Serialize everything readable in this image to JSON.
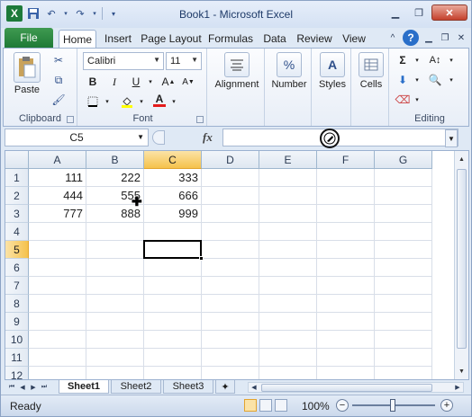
{
  "window": {
    "title": "Book1 - Microsoft Excel"
  },
  "qat": {
    "logo": "X",
    "save_icon": "save-icon",
    "undo_icon": "undo-icon",
    "redo_icon": "redo-icon"
  },
  "tabs": [
    {
      "label": "File"
    },
    {
      "label": "Home"
    },
    {
      "label": "Insert"
    },
    {
      "label": "Page Layout"
    },
    {
      "label": "Formulas"
    },
    {
      "label": "Data"
    },
    {
      "label": "Review"
    },
    {
      "label": "View"
    }
  ],
  "ribbon": {
    "clipboard": {
      "label": "Clipboard",
      "paste": "Paste"
    },
    "font": {
      "label": "Font",
      "name": "Calibri",
      "size": "11",
      "bold": "B",
      "italic": "I",
      "underline": "U",
      "font_color": "A"
    },
    "alignment": {
      "label": "Alignment"
    },
    "number": {
      "label": "Number",
      "icon": "%"
    },
    "styles": {
      "label": "Styles",
      "icon": "A"
    },
    "cells": {
      "label": "Cells"
    },
    "editing": {
      "label": "Editing",
      "sum": "Σ"
    }
  },
  "formula_bar": {
    "name_box": "C5",
    "fx": "fx",
    "value": ""
  },
  "grid": {
    "columns": [
      "A",
      "B",
      "C",
      "D",
      "E",
      "F",
      "G"
    ],
    "selected_column": "C",
    "rows": [
      "1",
      "2",
      "3",
      "4",
      "5",
      "6",
      "7",
      "8",
      "9",
      "10",
      "11",
      "12"
    ],
    "selected_row": "5",
    "cells": [
      [
        "111",
        "222",
        "333"
      ],
      [
        "444",
        "555",
        "666"
      ],
      [
        "777",
        "888",
        "999"
      ]
    ],
    "active_cell": "C5"
  },
  "sheets": [
    {
      "label": "Sheet1"
    },
    {
      "label": "Sheet2"
    },
    {
      "label": "Sheet3"
    }
  ],
  "status": {
    "mode": "Ready",
    "zoom": "100%"
  },
  "colors": {
    "file_tab": "#1f7a36",
    "selected_header": "#f5c24c",
    "close_button": "#c4402c"
  }
}
